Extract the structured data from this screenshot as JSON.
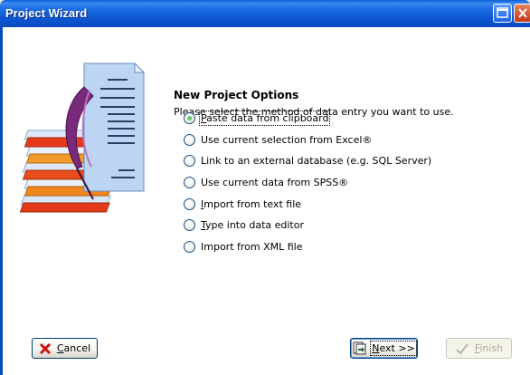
{
  "window": {
    "title": "Project Wizard"
  },
  "heading": "New Project Options",
  "subheading": "Please select the method of data entry you want to use.",
  "options": [
    {
      "pre": "",
      "key": "P",
      "post": "aste data from clipboard",
      "checked": true
    },
    {
      "pre": "",
      "key": "",
      "post": "Use current selection from Excel®",
      "checked": false
    },
    {
      "pre": "",
      "key": "",
      "post": "Link to an external database (e.g. SQL Server)",
      "checked": false
    },
    {
      "pre": "",
      "key": "",
      "post": "Use current data from SPSS®",
      "checked": false
    },
    {
      "pre": "",
      "key": "I",
      "post": "mport from text file",
      "checked": false
    },
    {
      "pre": "",
      "key": "T",
      "post": "ype into data editor",
      "checked": false
    },
    {
      "pre": "",
      "key": "",
      "post": "Import from XML file",
      "checked": false
    }
  ],
  "buttons": {
    "cancel": {
      "key": "C",
      "rest": "ancel"
    },
    "next": {
      "key": "N",
      "rest": "ext >>"
    },
    "finish": {
      "key": "F",
      "rest": "inish",
      "enabled": false
    }
  },
  "colors": {
    "titlebar": "#0a55d0",
    "check": "#21a121",
    "cancel_x": "#d01010"
  }
}
